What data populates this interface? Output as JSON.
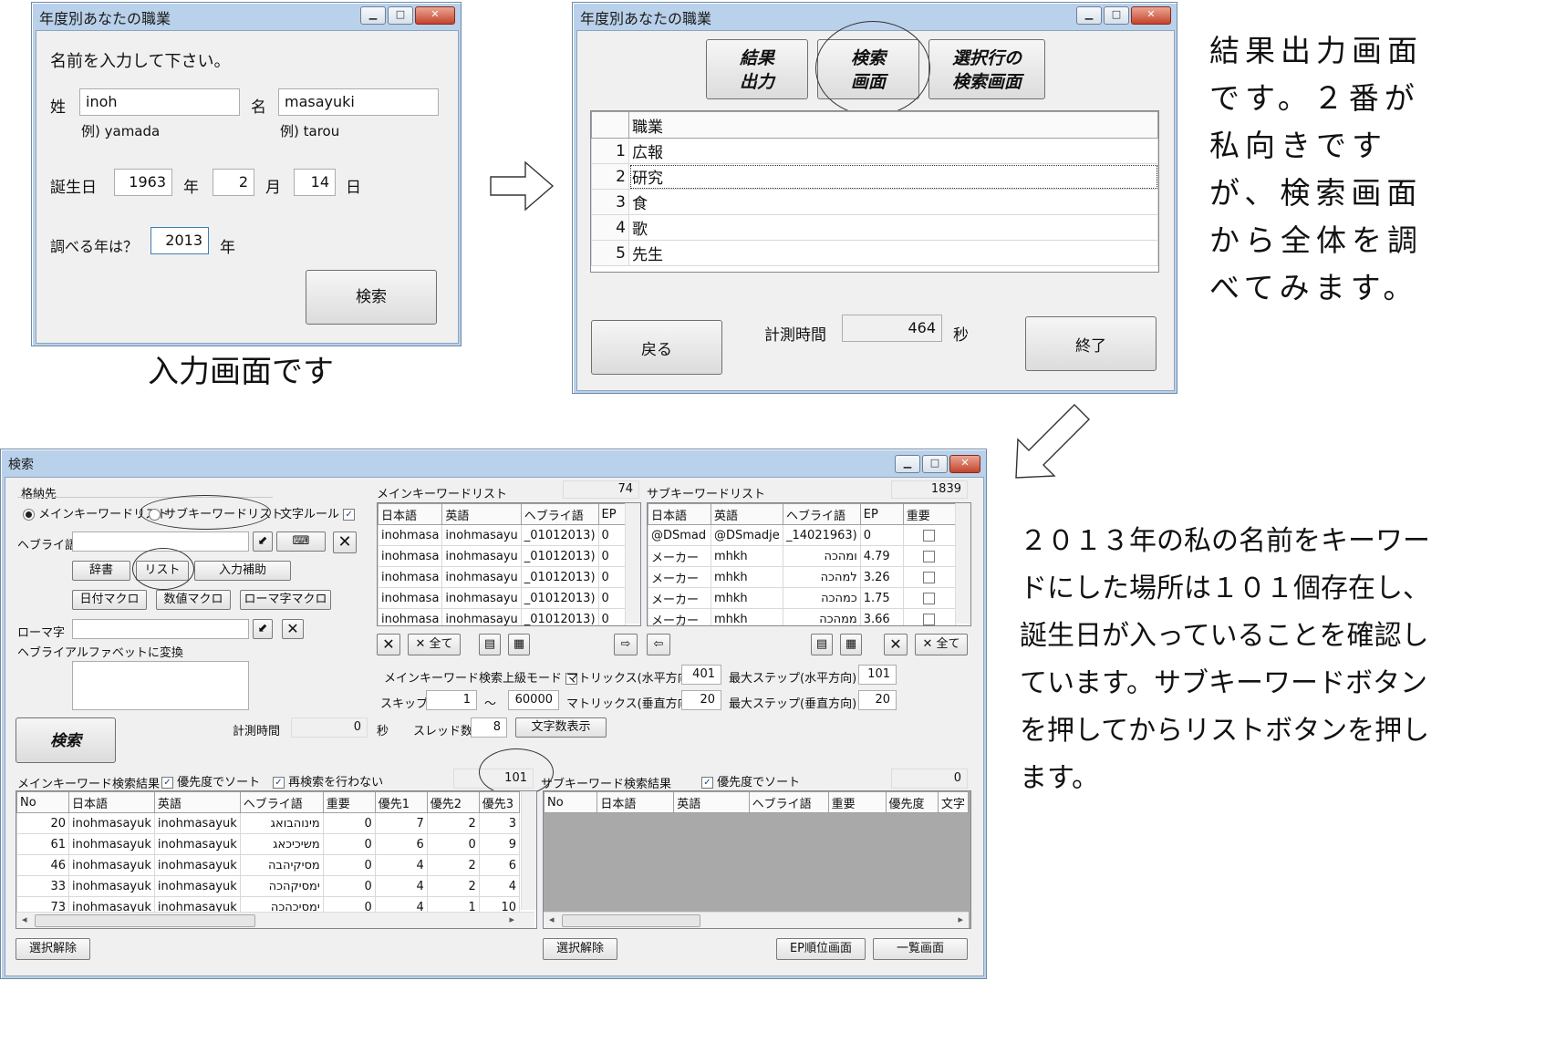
{
  "win1": {
    "title": "年度別あなたの職業",
    "prompt": "名前を入力して下さい。",
    "sei_label": "姓",
    "sei_value": "inoh",
    "sei_example": "例) yamada",
    "mei_label": "名",
    "mei_value": "masayuki",
    "mei_example": "例) tarou",
    "birth_label": "誕生日",
    "birth_year": "1963",
    "year_unit": "年",
    "birth_month": "2",
    "month_unit": "月",
    "birth_day": "14",
    "day_unit": "日",
    "target_label": "調べる年は？",
    "target_year": "2013",
    "target_unit": "年",
    "search_button": "検索"
  },
  "caption1": "入力画面です",
  "win2": {
    "title": "年度別あなたの職業",
    "btn_result_1": "結果",
    "btn_result_2": "出力",
    "btn_search_1": "検索",
    "btn_search_2": "画面",
    "btn_selrow_1": "選択行の",
    "btn_selrow_2": "検索画面",
    "column": "職業",
    "rows": [
      {
        "no": "1",
        "job": "広報"
      },
      {
        "no": "2",
        "job": "研究"
      },
      {
        "no": "3",
        "job": "食"
      },
      {
        "no": "4",
        "job": "歌"
      },
      {
        "no": "5",
        "job": "先生"
      }
    ],
    "back_button": "戻る",
    "time_label": "計測時間",
    "time_value": "464",
    "time_unit": "秒",
    "exit_button": "終了"
  },
  "caption2": "結果出力画面です。２番が私向きですが、検索画面から全体を調べてみます。",
  "win3": {
    "title": "検索",
    "store_label": "格納先",
    "radio_main": "メインキーワードリスト",
    "radio_sub": "サブキーワードリスト",
    "char_rule": "文字ルール",
    "hebrew_label": "ヘブライ語",
    "btn_dict": "辞書",
    "btn_list": "リスト",
    "btn_input_help": "入力補助",
    "btn_date_macro": "日付マクロ",
    "btn_num_macro": "数値マクロ",
    "btn_roman_macro": "ローマ字マクロ",
    "roman_label": "ローマ字",
    "convert_label": "ヘブライアルファベットに変換",
    "search_button": "検索",
    "time_label": "計測時間",
    "time_value": "0",
    "time_unit": "秒",
    "thread_label": "スレッド数",
    "thread_value": "8",
    "char_count_button": "文字数表示",
    "main_list_label": "メインキーワードリスト",
    "main_list_count": "74",
    "main_list_cols": [
      "日本語",
      "英語",
      "ヘブライ語",
      "EP"
    ],
    "main_list_rows": [
      [
        "inohmasa",
        "inohmasayu",
        "_01012013)",
        "0"
      ],
      [
        "inohmasa",
        "inohmasayu",
        "_01012013)",
        "0"
      ],
      [
        "inohmasa",
        "inohmasayu",
        "_01012013)",
        "0"
      ],
      [
        "inohmasa",
        "inohmasayu",
        "_01012013)",
        "0"
      ],
      [
        "inohmasa",
        "inohmasayu",
        "_01012013)",
        "0"
      ]
    ],
    "sub_list_label": "サブキーワードリスト",
    "sub_list_count": "1839",
    "sub_list_cols": [
      "日本語",
      "英語",
      "ヘブライ語",
      "EP",
      "重要"
    ],
    "sub_list_rows": [
      [
        "@DSmad",
        "@DSmadje",
        "_14021963)",
        "0"
      ],
      [
        "メーカー",
        "mhkh",
        "ומהכה",
        "4.79"
      ],
      [
        "メーカー",
        "mhkh",
        "למהכה",
        "3.26"
      ],
      [
        "メーカー",
        "mhkh",
        "כמהכה",
        "1.75"
      ],
      [
        "メーカー",
        "mhkh",
        "ממהכה",
        "3.66"
      ]
    ],
    "all_button": "全て",
    "adv_mode": "メインキーワード検索上級モード",
    "matrix_h_label": "マトリックス(水平方向)",
    "matrix_h": "401",
    "max_step_h_label": "最大ステップ(水平方向)",
    "max_step_h": "101",
    "skip_label": "スキップ",
    "skip_from": "1",
    "tilde": "～",
    "skip_to": "60000",
    "matrix_v_label": "マトリックス(垂直方向)",
    "matrix_v": "20",
    "max_step_v_label": "最大ステップ(垂直方向)",
    "max_step_v": "20",
    "main_result_label": "メインキーワード検索結果",
    "sort_priority": "優先度でソート",
    "no_research": "再検索を行わない",
    "main_result_count": "101",
    "main_result_cols": [
      "No",
      "日本語",
      "英語",
      "ヘブライ語",
      "重要",
      "優先1",
      "優先2",
      "優先3"
    ],
    "main_result_rows": [
      [
        "20",
        "inohmasayuk",
        "inohmasayuk",
        "מינוהבואג",
        "0",
        "7",
        "2",
        "3"
      ],
      [
        "61",
        "inohmasayuk",
        "inohmasayuk",
        "משיכיכאג",
        "0",
        "6",
        "0",
        "9"
      ],
      [
        "46",
        "inohmasayuk",
        "inohmasayuk",
        "מסיקיהבה",
        "0",
        "4",
        "2",
        "6"
      ],
      [
        "33",
        "inohmasayuk",
        "inohmasayuk",
        "ימסיקהכה",
        "0",
        "4",
        "2",
        "4"
      ],
      [
        "73",
        "inohmasayuk",
        "inohmasayuk",
        "ימסיכהכה",
        "0",
        "4",
        "1",
        "10"
      ]
    ],
    "sub_result_label": "サブキーワード検索結果",
    "sub_sort_priority": "優先度でソート",
    "sub_result_count": "0",
    "sub_result_cols": [
      "No",
      "日本語",
      "英語",
      "ヘブライ語",
      "重要",
      "優先度",
      "文字"
    ],
    "deselect_button": "選択解除",
    "ep_rank_button": "EP順位画面",
    "list_view_button": "一覧画面"
  },
  "caption3": "２０１３年の私の名前をキーワードにした場所は１０１個存在し、誕生日が入っていることを確認しています。サブキーワードボタンを押してからリストボタンを押します。"
}
